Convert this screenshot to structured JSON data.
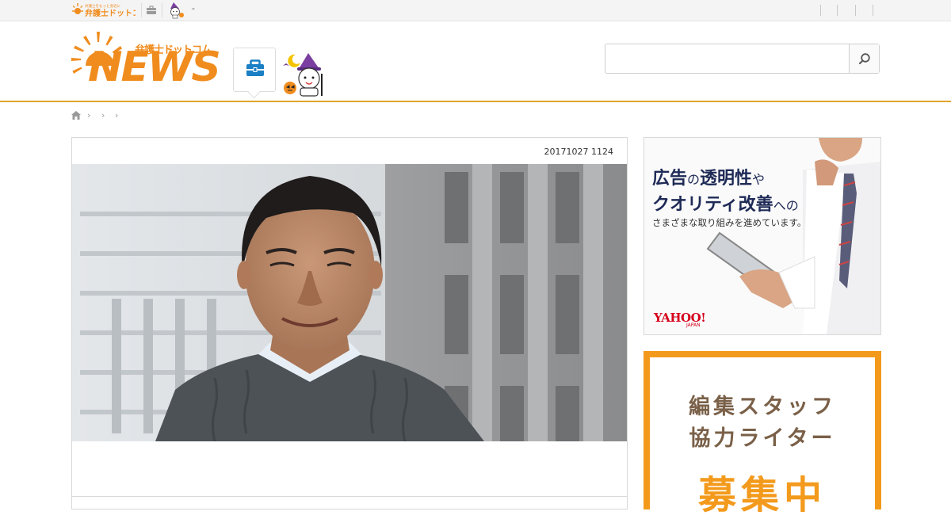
{
  "topbar": {
    "logo_tagline": "弁護士をもっと身近に",
    "logo_text": "弁護士ドットコム",
    "dash": "-"
  },
  "header": {
    "logo_sub": "弁護士ドットコム",
    "logo_main": "NEWS",
    "search": {
      "placeholder": "",
      "value": ""
    }
  },
  "article": {
    "date": "20171027 1124"
  },
  "ads": {
    "yahoo": {
      "line1_a": "広告",
      "line1_b": "の",
      "line1_c": "透明性",
      "line1_d": "や",
      "line2_a": "クオリティ改善",
      "line2_b": "への",
      "line3": "さまざまな取り組みを進めています。",
      "brand": "YAHOO!",
      "brand_sub": "JAPAN"
    },
    "recruit": {
      "line1": "編集スタッフ",
      "line2": "協力ライター",
      "line3": "募集中"
    }
  },
  "colors": {
    "brand_orange": "#f08c1e",
    "header_rule": "#e2a52b",
    "icon_blue": "#1a7fc4",
    "ad_navy": "#1e2a56",
    "recruit_orange": "#f39a1c",
    "recruit_brown": "#7a6048"
  },
  "icons": [
    "sun-logo-icon",
    "toolbox-icon",
    "mascot-icon",
    "search-icon",
    "home-icon"
  ]
}
